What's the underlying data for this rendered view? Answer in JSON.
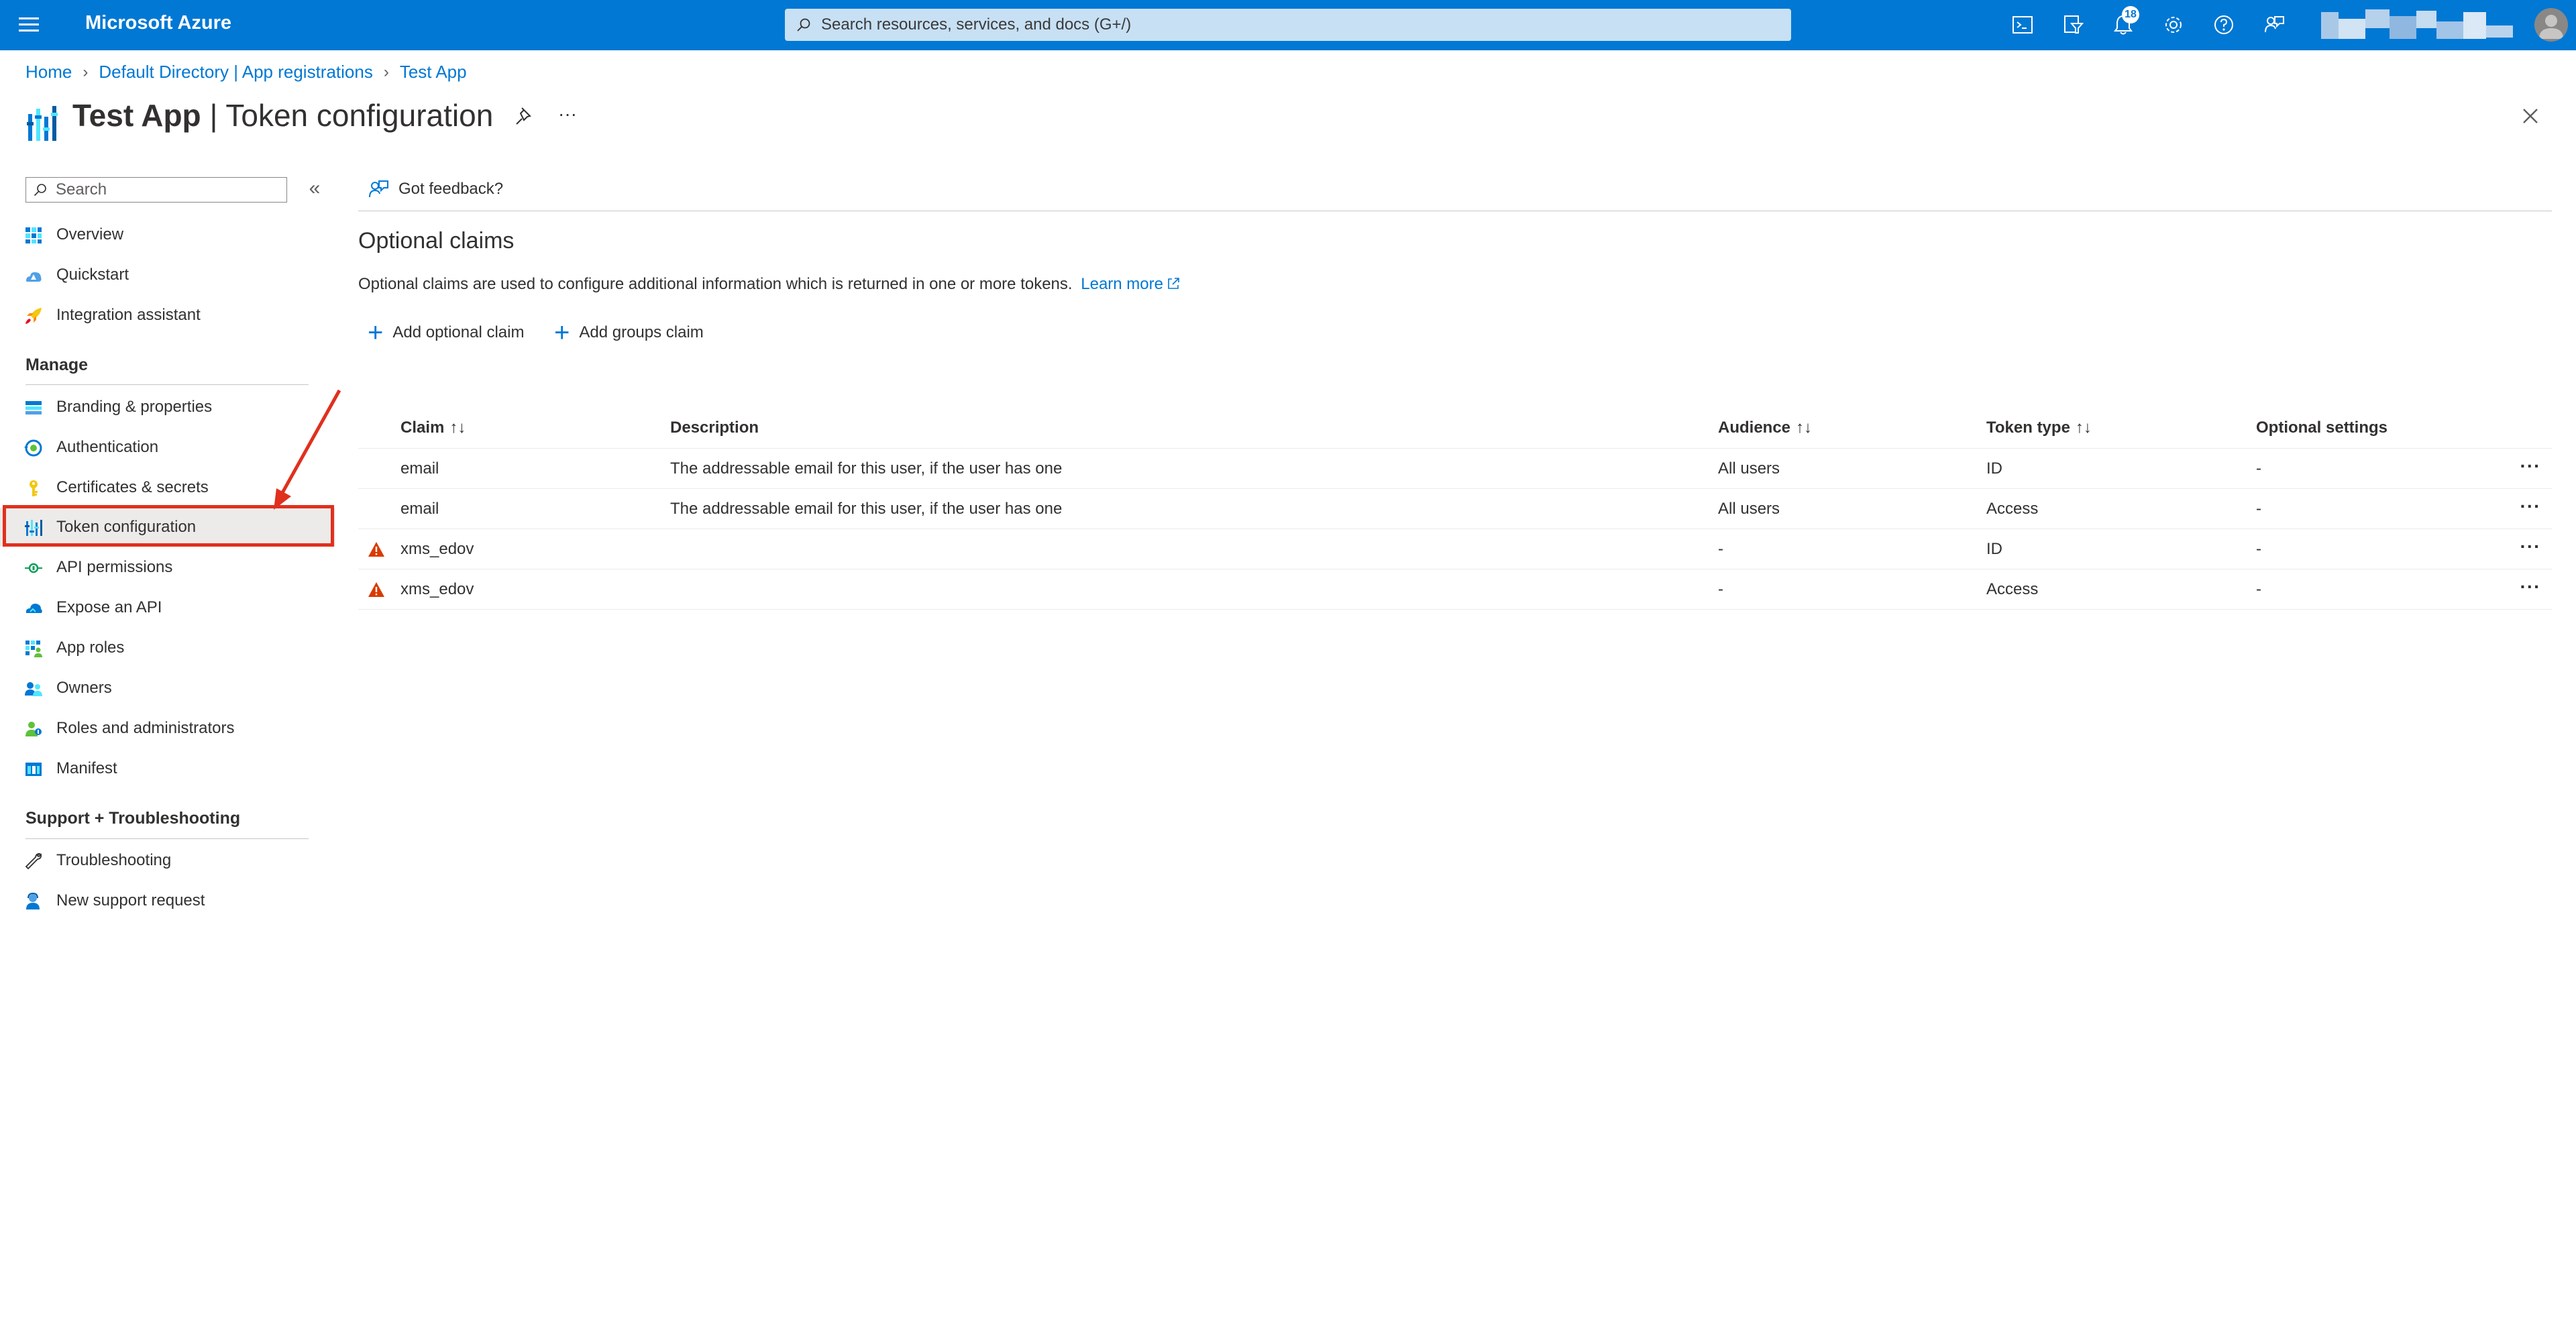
{
  "topbar": {
    "brand": "Microsoft Azure",
    "search_placeholder": "Search resources, services, and docs (G+/)",
    "notification_count": "18",
    "icons": [
      "cloud-shell-icon",
      "directory-filter-icon",
      "notifications-icon",
      "settings-icon",
      "help-icon",
      "feedback-icon"
    ]
  },
  "breadcrumb": {
    "items": [
      "Home",
      "Default Directory | App registrations",
      "Test App"
    ]
  },
  "header": {
    "app_name": "Test App",
    "separator": " | ",
    "page_name": "Token configuration",
    "more": "···"
  },
  "sidebar": {
    "search_placeholder": "Search",
    "collapse": "«",
    "top_items": [
      {
        "label": "Overview",
        "icon": "overview-icon"
      },
      {
        "label": "Quickstart",
        "icon": "quickstart-icon"
      },
      {
        "label": "Integration assistant",
        "icon": "rocket-icon"
      }
    ],
    "manage_heading": "Manage",
    "manage_items": [
      {
        "label": "Branding & properties",
        "icon": "branding-icon"
      },
      {
        "label": "Authentication",
        "icon": "authentication-icon"
      },
      {
        "label": "Certificates & secrets",
        "icon": "key-icon"
      },
      {
        "label": "Token configuration",
        "icon": "token-configuration-icon",
        "selected": true
      },
      {
        "label": "API permissions",
        "icon": "api-permissions-icon"
      },
      {
        "label": "Expose an API",
        "icon": "cloud-icon"
      },
      {
        "label": "App roles",
        "icon": "app-roles-icon"
      },
      {
        "label": "Owners",
        "icon": "owners-icon"
      },
      {
        "label": "Roles and administrators",
        "icon": "roles-icon"
      },
      {
        "label": "Manifest",
        "icon": "manifest-icon"
      }
    ],
    "support_heading": "Support + Troubleshooting",
    "support_items": [
      {
        "label": "Troubleshooting",
        "icon": "wrench-icon"
      },
      {
        "label": "New support request",
        "icon": "support-icon"
      }
    ]
  },
  "main": {
    "feedback_label": "Got feedback?",
    "section_title": "Optional claims",
    "section_description": "Optional claims are used to configure additional information which is returned in one or more tokens.",
    "learn_more": "Learn more",
    "add_optional_claim": "Add optional claim",
    "add_groups_claim": "Add groups claim",
    "plus": "+"
  },
  "table": {
    "columns": {
      "claim": "Claim",
      "description": "Description",
      "audience": "Audience",
      "token_type": "Token type",
      "optional_settings": "Optional settings"
    },
    "sort_claim": "↑↓",
    "sort_audience": "↑↓",
    "sort_token_type": "↑↓",
    "row_more": "···",
    "rows": [
      {
        "warning": false,
        "claim": "email",
        "description": "The addressable email for this user, if the user has one",
        "audience": "All users",
        "token_type": "ID",
        "optional_settings": "-"
      },
      {
        "warning": false,
        "claim": "email",
        "description": "The addressable email for this user, if the user has one",
        "audience": "All users",
        "token_type": "Access",
        "optional_settings": "-"
      },
      {
        "warning": true,
        "claim": "xms_edov",
        "description": "",
        "audience": "-",
        "token_type": "ID",
        "optional_settings": "-"
      },
      {
        "warning": true,
        "claim": "xms_edov",
        "description": "",
        "audience": "-",
        "token_type": "Access",
        "optional_settings": "-"
      }
    ]
  },
  "colors": {
    "azure_blue": "#0078d4",
    "highlight_red": "#e0301e",
    "warning_orange": "#d83b01"
  }
}
